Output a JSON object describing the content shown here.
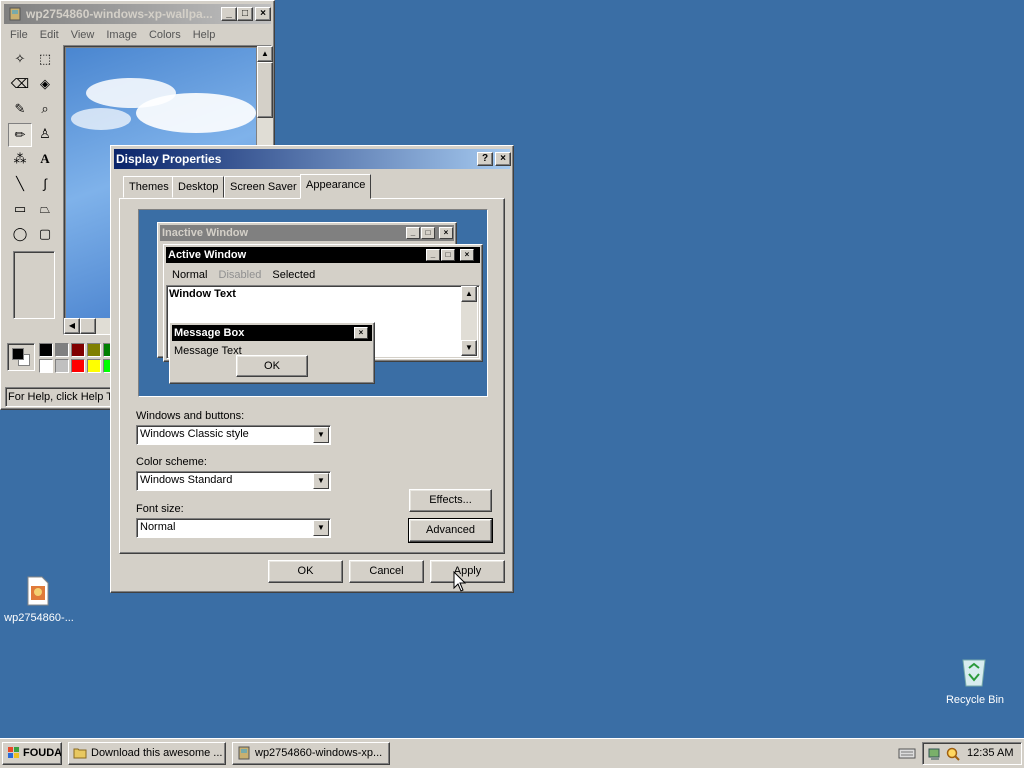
{
  "paint": {
    "title": "wp2754860-windows-xp-wallpa...",
    "menu": [
      "File",
      "Edit",
      "View",
      "Image",
      "Colors",
      "Help"
    ],
    "status": "For Help, click Help To"
  },
  "dialog": {
    "title": "Display Properties",
    "help_glyph": "?",
    "close_glyph": "×",
    "tabs": [
      "Themes",
      "Desktop",
      "Screen Saver",
      "Appearance"
    ],
    "active_tab": "Appearance",
    "preview": {
      "inactive_title": "Inactive Window",
      "active_title": "Active Window",
      "menu_normal": "Normal",
      "menu_disabled": "Disabled",
      "menu_selected": "Selected",
      "window_text": "Window Text",
      "msgbox_title": "Message Box",
      "msgbox_text": "Message Text",
      "msgbox_ok": "OK"
    },
    "windows_buttons_label": "Windows and buttons:",
    "windows_buttons_value": "Windows Classic style",
    "color_scheme_label": "Color scheme:",
    "color_scheme_value": "Windows Standard",
    "font_size_label": "Font size:",
    "font_size_value": "Normal",
    "effects_label": "Effects...",
    "advanced_label": "Advanced",
    "ok_label": "OK",
    "cancel_label": "Cancel",
    "apply_label": "Apply"
  },
  "desktop": {
    "file_icon_label": "wp2754860-...",
    "recycle_bin_label": "Recycle Bin"
  },
  "taskbar": {
    "start_label": "FOUDA",
    "tasks": [
      "Download this awesome ...",
      "wp2754860-windows-xp..."
    ],
    "clock": "12:35 AM"
  },
  "colors": {
    "desktop": "#3a6ea5",
    "active_title": "#0a246a",
    "inactive_title": "#808080",
    "face": "#d4d0c8"
  }
}
